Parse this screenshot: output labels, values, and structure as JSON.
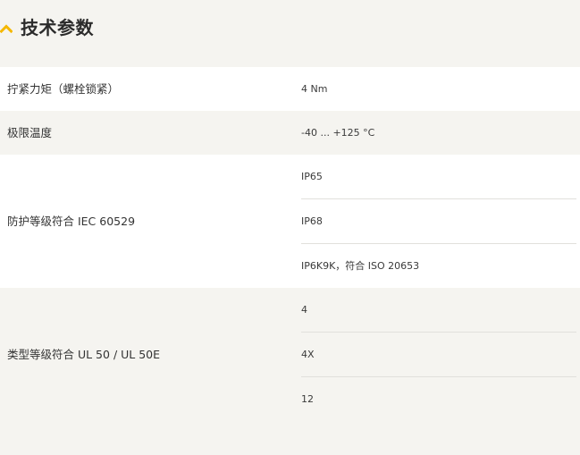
{
  "section": {
    "title": "技术参数",
    "accent_color": "#f5b800",
    "toggle_icon": "chevron-up-icon"
  },
  "specs": [
    {
      "label": "拧紧力矩（螺栓锁紧）",
      "values": [
        "4 Nm"
      ]
    },
    {
      "label": "极限温度",
      "values": [
        "-40 ... +125 °C"
      ]
    },
    {
      "label": "防护等级符合 IEC 60529",
      "values": [
        "IP65",
        "IP68",
        "IP6K9K，符合 ISO 20653"
      ]
    },
    {
      "label": "类型等级符合 UL 50 / UL 50E",
      "values": [
        "4",
        "4X",
        "12"
      ]
    }
  ]
}
